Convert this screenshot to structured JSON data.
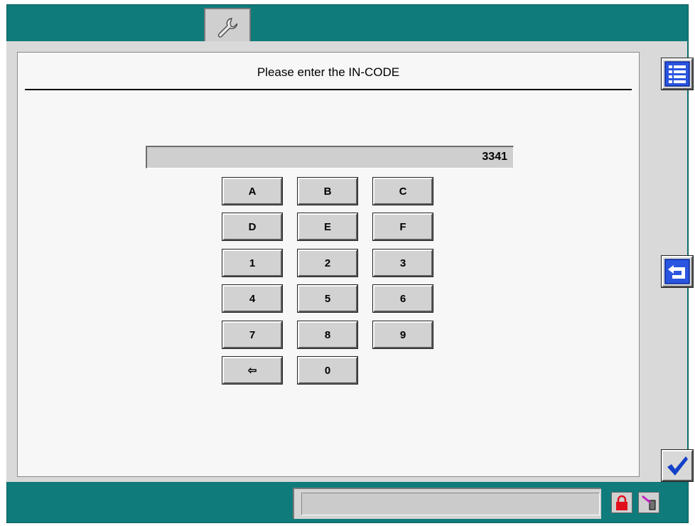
{
  "header": {
    "prompt": "Please enter the IN-CODE"
  },
  "code_input": {
    "value": "3341"
  },
  "keypad": {
    "keys": [
      {
        "label": "A",
        "name": "key-a"
      },
      {
        "label": "B",
        "name": "key-b"
      },
      {
        "label": "C",
        "name": "key-c"
      },
      {
        "label": "D",
        "name": "key-d"
      },
      {
        "label": "E",
        "name": "key-e"
      },
      {
        "label": "F",
        "name": "key-f"
      },
      {
        "label": "1",
        "name": "key-1"
      },
      {
        "label": "2",
        "name": "key-2"
      },
      {
        "label": "3",
        "name": "key-3"
      },
      {
        "label": "4",
        "name": "key-4"
      },
      {
        "label": "5",
        "name": "key-5"
      },
      {
        "label": "6",
        "name": "key-6"
      },
      {
        "label": "7",
        "name": "key-7"
      },
      {
        "label": "8",
        "name": "key-8"
      },
      {
        "label": "9",
        "name": "key-9"
      },
      {
        "label": "⇦",
        "name": "key-backspace"
      },
      {
        "label": "0",
        "name": "key-0"
      }
    ]
  },
  "toolbar": {
    "tab_icon": "wrench-icon",
    "menu_icon": "list-menu-icon",
    "back_icon": "return-arrow-icon",
    "confirm_icon": "checkmark-icon"
  },
  "status": {
    "lock_icon": "padlock-icon",
    "connection_icon": "cable-connector-icon"
  },
  "colors": {
    "frame": "#0f7b7b",
    "accent_blue": "#1340c8",
    "lock_red": "#e0101c"
  }
}
